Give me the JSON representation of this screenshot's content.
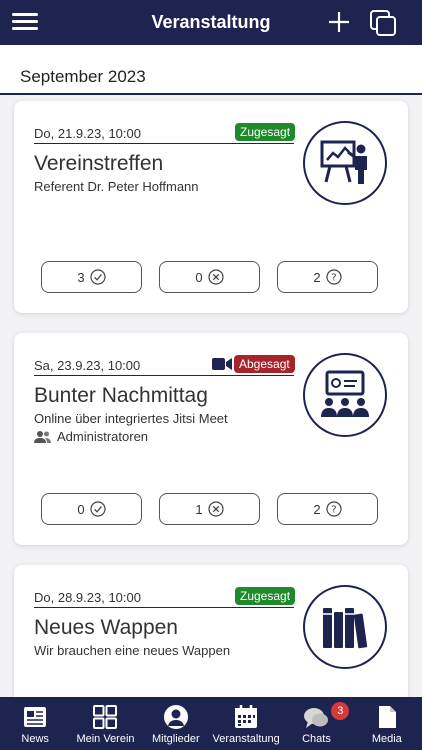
{
  "header": {
    "title": "Veranstaltung"
  },
  "month": "September 2023",
  "events": [
    {
      "date": "Do, 21.9.23, 10:00",
      "status": "Zugesagt",
      "title": "Vereinstreffen",
      "subtitle": "Referent Dr. Peter Hoffmann",
      "yes": "3",
      "no": "0",
      "maybe": "2"
    },
    {
      "date": "Sa, 23.9.23, 10:00",
      "status": "Abgesagt",
      "title": "Bunter Nachmittag",
      "subtitle": "Online über integriertes Jitsi Meet",
      "group": "Administratoren",
      "yes": "0",
      "no": "1",
      "maybe": "2"
    },
    {
      "date": "Do, 28.9.23, 10:00",
      "status": "Zugesagt",
      "title": "Neues Wappen",
      "subtitle": "Wir brauchen eine neues Wappen"
    }
  ],
  "nav": [
    {
      "label": "News",
      "icon": "news-icon"
    },
    {
      "label": "Mein Verein",
      "icon": "grid-icon"
    },
    {
      "label": "Mitglieder",
      "icon": "person-icon"
    },
    {
      "label": "Veranstaltung",
      "icon": "calendar-icon"
    },
    {
      "label": "Chats",
      "icon": "chat-icon",
      "badge": "3"
    },
    {
      "label": "Media",
      "icon": "document-icon"
    }
  ],
  "colors": {
    "navy": "#1e2450",
    "accepted": "#1f8a2c",
    "declined": "#a8242b",
    "badge": "#d43a3a"
  }
}
